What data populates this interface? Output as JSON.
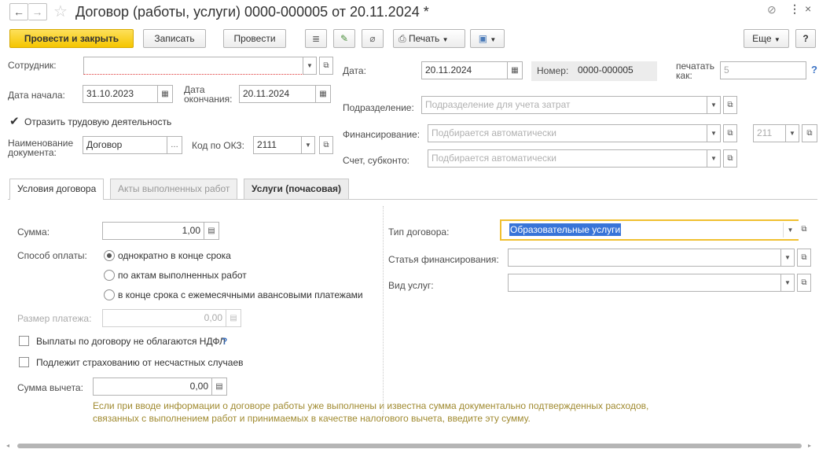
{
  "window": {
    "title": "Договор (работы, услуги) 0000-000005 от 20.11.2024 *"
  },
  "toolbar": {
    "post_close": "Провести и закрыть",
    "save": "Записать",
    "post": "Провести",
    "print": "Печать",
    "more": "Еще",
    "help": "?"
  },
  "header": {
    "employee_label": "Сотрудник:",
    "employee_value": "",
    "date_label": "Дата:",
    "date_value": "20.11.2024",
    "number_label": "Номер:",
    "number_value": "0000-000005",
    "print_as_label": "печатать как:",
    "print_as_value": "5",
    "start_label": "Дата начала:",
    "start_value": "31.10.2023",
    "end_label": "Дата окончания:",
    "end_value": "20.11.2024",
    "dept_label": "Подразделение:",
    "dept_placeholder": "Подразделение для учета затрат",
    "reflect_label": "Отразить трудовую деятельность",
    "reflect_checked": true,
    "funding_label": "Финансирование:",
    "funding_placeholder": "Подбирается автоматически",
    "funding_code": "211",
    "doc_name_label": "Наименование документа:",
    "doc_name_value": "Договор",
    "okz_label": "Код по ОКЗ:",
    "okz_value": "2111",
    "account_label": "Счет, субконто:",
    "account_placeholder": "Подбирается автоматически"
  },
  "tabs": [
    "Условия договора",
    "Акты выполненных работ",
    "Услуги (почасовая)"
  ],
  "conditions": {
    "sum_label": "Сумма:",
    "sum_value": "1,00",
    "pay_method_label": "Способ оплаты:",
    "pay_options": [
      "однократно в конце срока",
      "по актам выполненных работ",
      "в конце срока с ежемесячными авансовыми платежами"
    ],
    "pay_selected": 0,
    "payment_size_label": "Размер платежа:",
    "payment_size_value": "0,00",
    "no_ndfl_label": "Выплаты по договору не облагаются НДФЛ",
    "no_ndfl_help": "?",
    "insurance_label": "Подлежит страхованию от несчастных случаев",
    "deduction_label": "Сумма вычета:",
    "deduction_value": "0,00",
    "hint": "Если при вводе информации о договоре работы уже выполнены и известна сумма документально подтвержденных расходов, связанных с выполнением работ и принимаемых в качестве налогового вычета, введите эту сумму.",
    "contract_type_label": "Тип договора:",
    "contract_type_value": "Образовательные услуги",
    "funding_article_label": "Статья финансирования:",
    "service_type_label": "Вид услуг:"
  },
  "colors": {
    "accent_yellow": "#f5c500",
    "focus_border": "#f0c030",
    "selection": "#3874d8"
  }
}
